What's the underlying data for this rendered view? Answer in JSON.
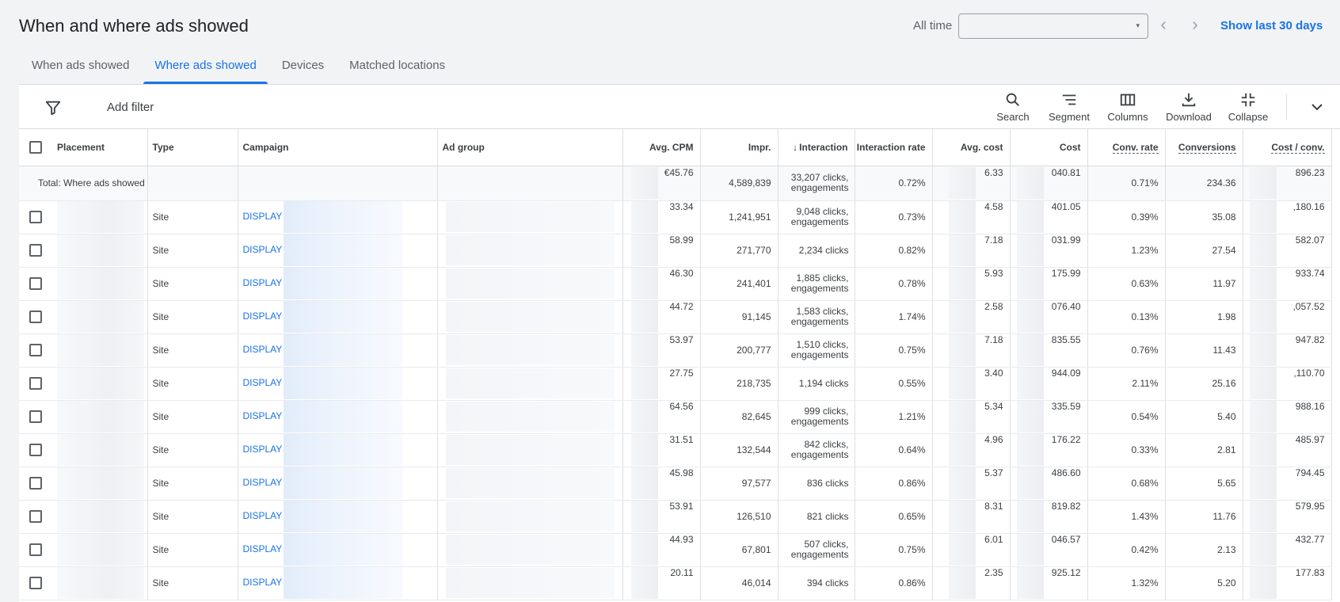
{
  "header": {
    "title": "When and where ads showed",
    "date_label": "All time",
    "date_value": "",
    "show_last": "Show last 30 days"
  },
  "tabs": [
    {
      "label": "When ads showed"
    },
    {
      "label": "Where ads showed"
    },
    {
      "label": "Devices"
    },
    {
      "label": "Matched locations"
    }
  ],
  "toolbar": {
    "add_filter": "Add filter",
    "search": "Search",
    "segment": "Segment",
    "columns": "Columns",
    "download": "Download",
    "collapse": "Collapse"
  },
  "table": {
    "headers": {
      "placement": "Placement",
      "type": "Type",
      "campaign": "Campaign",
      "ad_group": "Ad group",
      "avg_cpm": "Avg. CPM",
      "impr": "Impr.",
      "interaction": "Interaction",
      "interaction_rate": "Interaction rate",
      "avg_cost": "Avg. cost",
      "cost": "Cost",
      "conv_rate": "Conv. rate",
      "conversions": "Conversions",
      "cost_conv": "Cost / conv."
    },
    "total": {
      "label": "Total: Where ads showed",
      "avg_cpm": "€45.76",
      "impr": "4,589,839",
      "interaction": "33,207 clicks, engagements",
      "interaction_rate": "0.72%",
      "avg_cost": "6.33",
      "cost": "040.81",
      "conv_rate": "0.71%",
      "conversions": "234.36",
      "cost_conv": "896.23"
    },
    "rows": [
      {
        "type": "Site",
        "campaign": "DISPLAY",
        "avg_cpm": "33.34",
        "impr": "1,241,951",
        "interaction": "9,048 clicks, engagements",
        "interaction_rate": "0.73%",
        "avg_cost": "4.58",
        "cost": "401.05",
        "conv_rate": "0.39%",
        "conversions": "35.08",
        "cost_conv": ",180.16"
      },
      {
        "type": "Site",
        "campaign": "DISPLAY",
        "avg_cpm": "58.99",
        "impr": "271,770",
        "interaction": "2,234 clicks",
        "interaction_rate": "0.82%",
        "avg_cost": "7.18",
        "cost": "031.99",
        "conv_rate": "1.23%",
        "conversions": "27.54",
        "cost_conv": "582.07"
      },
      {
        "type": "Site",
        "campaign": "DISPLAY",
        "avg_cpm": "46.30",
        "impr": "241,401",
        "interaction": "1,885 clicks, engagements",
        "interaction_rate": "0.78%",
        "avg_cost": "5.93",
        "cost": "175.99",
        "conv_rate": "0.63%",
        "conversions": "11.97",
        "cost_conv": "933.74"
      },
      {
        "type": "Site",
        "campaign": "DISPLAY",
        "avg_cpm": "44.72",
        "impr": "91,145",
        "interaction": "1,583 clicks, engagements",
        "interaction_rate": "1.74%",
        "avg_cost": "2.58",
        "cost": "076.40",
        "conv_rate": "0.13%",
        "conversions": "1.98",
        "cost_conv": ",057.52"
      },
      {
        "type": "Site",
        "campaign": "DISPLAY",
        "avg_cpm": "53.97",
        "impr": "200,777",
        "interaction": "1,510 clicks, engagements",
        "interaction_rate": "0.75%",
        "avg_cost": "7.18",
        "cost": "835.55",
        "conv_rate": "0.76%",
        "conversions": "11.43",
        "cost_conv": "947.82"
      },
      {
        "type": "Site",
        "campaign": "DISPLAY",
        "avg_cpm": "27.75",
        "impr": "218,735",
        "interaction": "1,194 clicks",
        "interaction_rate": "0.55%",
        "avg_cost": "3.40",
        "cost": "944.09",
        "conv_rate": "2.11%",
        "conversions": "25.16",
        "cost_conv": ",110.70"
      },
      {
        "type": "Site",
        "campaign": "DISPLAY",
        "avg_cpm": "64.56",
        "impr": "82,645",
        "interaction": "999 clicks, engagements",
        "interaction_rate": "1.21%",
        "avg_cost": "5.34",
        "cost": "335.59",
        "conv_rate": "0.54%",
        "conversions": "5.40",
        "cost_conv": "988.16"
      },
      {
        "type": "Site",
        "campaign": "DISPLAY",
        "avg_cpm": "31.51",
        "impr": "132,544",
        "interaction": "842 clicks, engagements",
        "interaction_rate": "0.64%",
        "avg_cost": "4.96",
        "cost": "176.22",
        "conv_rate": "0.33%",
        "conversions": "2.81",
        "cost_conv": "485.97"
      },
      {
        "type": "Site",
        "campaign": "DISPLAY",
        "avg_cpm": "45.98",
        "impr": "97,577",
        "interaction": "836 clicks",
        "interaction_rate": "0.86%",
        "avg_cost": "5.37",
        "cost": "486.60",
        "conv_rate": "0.68%",
        "conversions": "5.65",
        "cost_conv": "794.45"
      },
      {
        "type": "Site",
        "campaign": "DISPLAY",
        "avg_cpm": "53.91",
        "impr": "126,510",
        "interaction": "821 clicks",
        "interaction_rate": "0.65%",
        "avg_cost": "8.31",
        "cost": "819.82",
        "conv_rate": "1.43%",
        "conversions": "11.76",
        "cost_conv": "579.95"
      },
      {
        "type": "Site",
        "campaign": "DISPLAY",
        "avg_cpm": "44.93",
        "impr": "67,801",
        "interaction": "507 clicks, engagements",
        "interaction_rate": "0.75%",
        "avg_cost": "6.01",
        "cost": "046.57",
        "conv_rate": "0.42%",
        "conversions": "2.13",
        "cost_conv": "432.77"
      },
      {
        "type": "Site",
        "campaign": "DISPLAY",
        "avg_cpm": "20.11",
        "impr": "46,014",
        "interaction": "394 clicks",
        "interaction_rate": "0.86%",
        "avg_cost": "2.35",
        "cost": "925.12",
        "conv_rate": "1.32%",
        "conversions": "5.20",
        "cost_conv": "177.83"
      }
    ]
  }
}
